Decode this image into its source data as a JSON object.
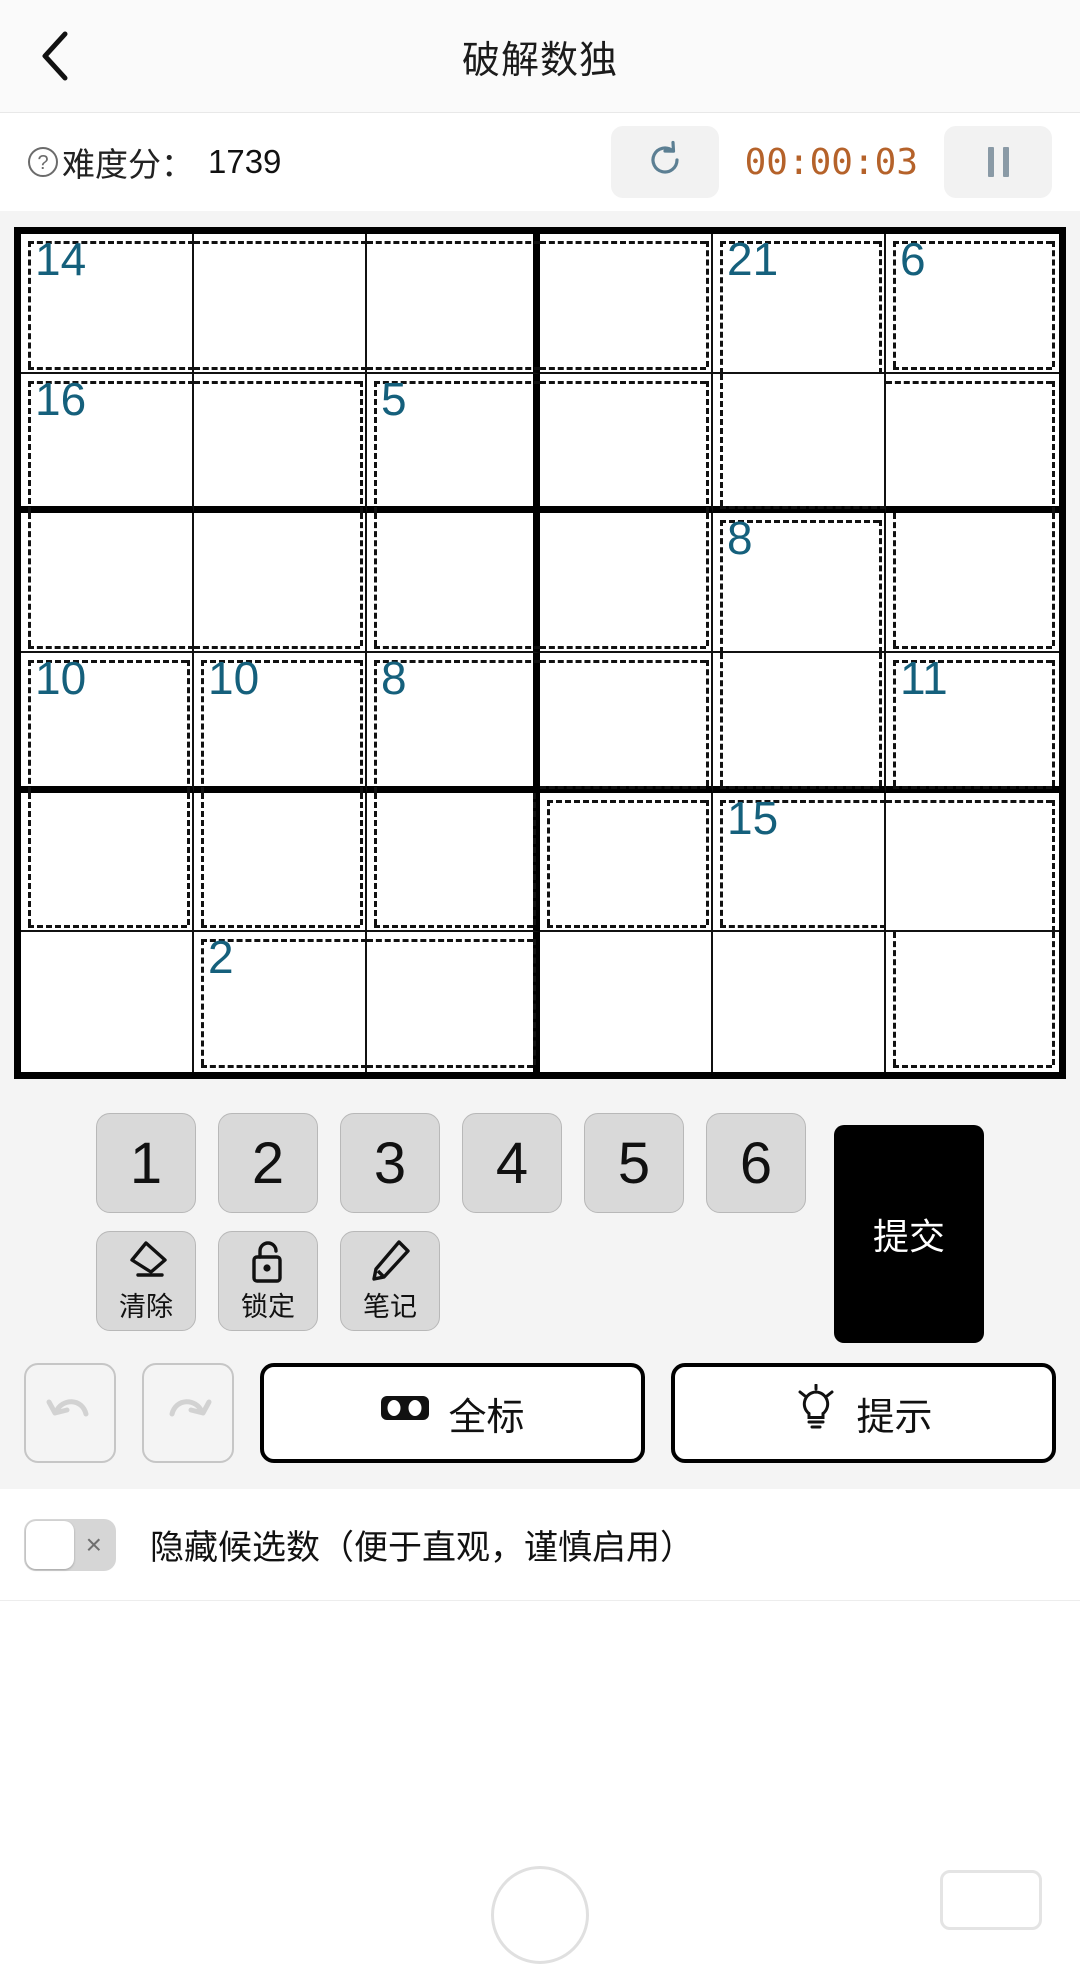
{
  "header": {
    "title": "破解数独",
    "back_icon": "chevron-left-icon"
  },
  "info_bar": {
    "help_icon": "question-circle-icon",
    "difficulty_label": "难度分：",
    "difficulty_value": "1739",
    "refresh_icon": "refresh-icon",
    "timer": "00:00:03",
    "pause_icon": "pause-icon"
  },
  "board": {
    "size": 6,
    "cage_sums": {
      "r1c1": "14",
      "r1c5": "21",
      "r1c6": "6",
      "r2c1": "16",
      "r2c3": "5",
      "r3c5": "8",
      "r4c1": "10",
      "r4c2": "10",
      "r4c3": "8",
      "r5c5": "15",
      "r5c6": "11",
      "r6c2": "2"
    },
    "cells": [
      [
        "",
        "",
        "",
        "",
        "",
        ""
      ],
      [
        "",
        "",
        "",
        "",
        "",
        ""
      ],
      [
        "",
        "",
        "",
        "",
        "",
        ""
      ],
      [
        "",
        "",
        "",
        "",
        "",
        ""
      ],
      [
        "",
        "",
        "",
        "",
        "",
        ""
      ],
      [
        "",
        "",
        "",
        "",
        "",
        ""
      ]
    ],
    "cages": [
      {
        "sum": "14",
        "cells": [
          [
            0,
            0
          ],
          [
            0,
            1
          ],
          [
            0,
            2
          ],
          [
            0,
            3
          ]
        ]
      },
      {
        "sum": "21",
        "cells": [
          [
            0,
            4
          ],
          [
            1,
            4
          ],
          [
            1,
            5
          ],
          [
            2,
            5
          ]
        ]
      },
      {
        "sum": "6",
        "cells": [
          [
            0,
            5
          ]
        ]
      },
      {
        "sum": "16",
        "cells": [
          [
            1,
            0
          ],
          [
            1,
            1
          ],
          [
            2,
            0
          ],
          [
            2,
            1
          ]
        ]
      },
      {
        "sum": "5",
        "cells": [
          [
            1,
            2
          ],
          [
            1,
            3
          ],
          [
            2,
            2
          ],
          [
            2,
            3
          ]
        ]
      },
      {
        "sum": "8",
        "cells": [
          [
            2,
            4
          ],
          [
            3,
            4
          ]
        ]
      },
      {
        "sum": "10",
        "cells": [
          [
            3,
            0
          ],
          [
            4,
            0
          ]
        ]
      },
      {
        "sum": "10",
        "cells": [
          [
            3,
            1
          ],
          [
            4,
            1
          ]
        ]
      },
      {
        "sum": "8",
        "cells": [
          [
            3,
            2
          ],
          [
            3,
            3
          ],
          [
            4,
            2
          ]
        ]
      },
      {
        "sum": "15",
        "cells": [
          [
            4,
            4
          ],
          [
            4,
            5
          ],
          [
            5,
            5
          ]
        ]
      },
      {
        "sum": "11",
        "cells": [
          [
            3,
            5
          ],
          [
            4,
            3
          ]
        ]
      },
      {
        "sum": "2",
        "cells": [
          [
            5,
            1
          ],
          [
            5,
            2
          ]
        ]
      }
    ]
  },
  "keypad": {
    "numbers": [
      "1",
      "2",
      "3",
      "4",
      "5",
      "6"
    ],
    "tools": [
      {
        "label": "清除",
        "icon": "eraser-icon"
      },
      {
        "label": "锁定",
        "icon": "lock-icon"
      },
      {
        "label": "笔记",
        "icon": "pencil-icon"
      }
    ],
    "submit_label": "提交"
  },
  "actions": {
    "undo_icon": "undo-icon",
    "redo_icon": "redo-icon",
    "mark_all_label": "全标",
    "mark_all_icon": "goggles-icon",
    "hint_label": "提示",
    "hint_icon": "lightbulb-icon"
  },
  "toggle": {
    "state": "off",
    "state_mark": "×",
    "label": "隐藏候选数（便于直观，谨慎启用）"
  },
  "colors": {
    "cage_sum": "#15607c",
    "timer": "#b5622a",
    "submit_bg": "#000000",
    "board_line": "#111111",
    "keypad_bg": "#d9d9d9"
  }
}
